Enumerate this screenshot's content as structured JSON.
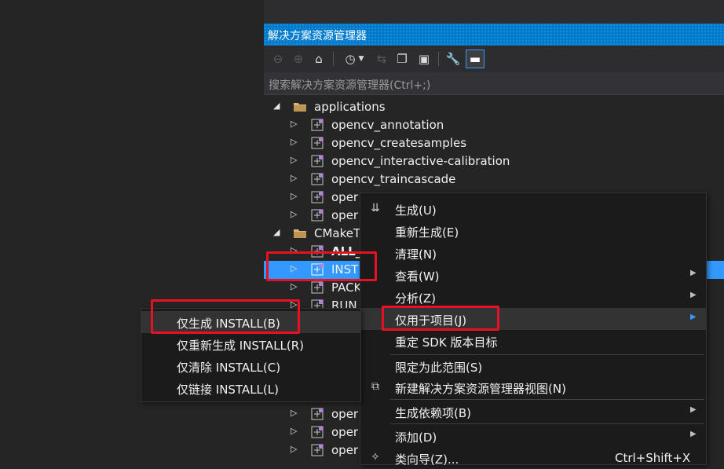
{
  "panel": {
    "title": "解决方案资源管理器",
    "search_placeholder": "搜索解决方案资源管理器(Ctrl+;)"
  },
  "toolbar": {
    "icons": [
      "back-icon",
      "forward-icon",
      "home-icon",
      "history-icon",
      "sync-icon",
      "collapse-all-icon",
      "show-all-files-icon",
      "properties-wrench-icon",
      "preview-pin-icon"
    ]
  },
  "tree": {
    "folder_applications": "applications",
    "folder_cmake": "CMakeT",
    "items": [
      "opencv_annotation",
      "opencv_createsamples",
      "opencv_interactive-calibration",
      "opencv_traincascade",
      "oper",
      "oper",
      "ALL_",
      "INST",
      "PACK",
      "RUN_",
      "oper",
      "oper",
      "oper"
    ]
  },
  "context_menu": {
    "items": [
      {
        "label": "生成(U)",
        "icon": "build-icon"
      },
      {
        "label": "重新生成(E)"
      },
      {
        "label": "清理(N)"
      },
      {
        "label": "查看(W)",
        "submenu": true
      },
      {
        "label": "分析(Z)",
        "submenu": true
      },
      {
        "label": "仅用于项目(J)",
        "submenu": true
      },
      {
        "label": "重定 SDK 版本目标"
      },
      {
        "label": "限定为此范围(S)"
      },
      {
        "label": "新建解决方案资源管理器视图(N)",
        "icon": "new-view-icon"
      },
      {
        "label": "生成依赖项(B)",
        "submenu": true
      },
      {
        "label": "添加(D)",
        "submenu": true
      },
      {
        "label": "类向导(Z)...",
        "shortcut": "Ctrl+Shift+X",
        "icon": "class-wizard-icon"
      }
    ]
  },
  "project_only_submenu": {
    "items": [
      "仅生成 INSTALL(B)",
      "仅重新生成 INSTALL(R)",
      "仅清除 INSTALL(C)",
      "仅链接 INSTALL(L)"
    ]
  },
  "colors": {
    "accent": "#007acc",
    "selection": "#3399ff",
    "highlight_box": "#e81123",
    "background": "#252526",
    "menu_bg": "#1b1b1c"
  }
}
